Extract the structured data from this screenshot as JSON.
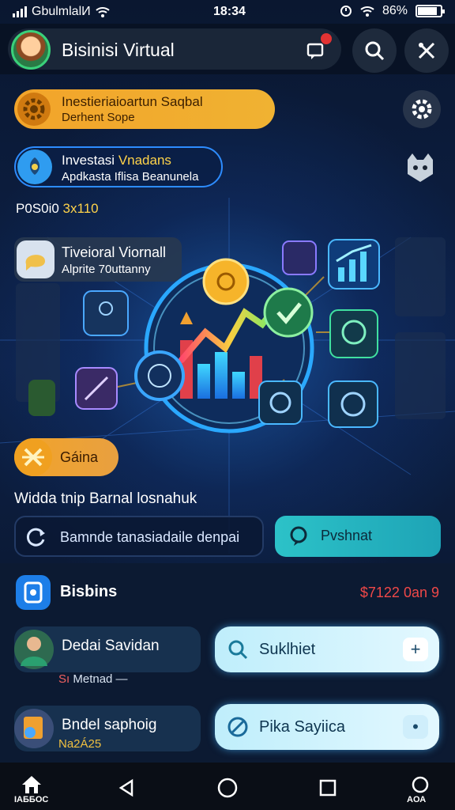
{
  "status_bar": {
    "carrier": "GbulmlalИ",
    "time": "18:34",
    "battery": "86%",
    "battery_level": 0.86
  },
  "header": {
    "title": "Bisinisi Virtual",
    "notification_icon": "message-icon",
    "search_icon": "search-icon",
    "tools_icon": "tools-icon"
  },
  "cards": {
    "orange": {
      "title": "Inestieriaioartun Saqbal",
      "subtitle": "Derhent Sope"
    },
    "blue": {
      "title_prefix": "Investasi ",
      "title_highlight": "Vnadans",
      "subtitle": "Apdkasta Iflisa Beanunela"
    },
    "post": {
      "prefix": "P0S0i0 ",
      "value": "3х110"
    },
    "tiles": {
      "title": "Tiveioral Viornall",
      "subtitle": "Alprite  70uttanny"
    }
  },
  "gain_button": {
    "label": "Gáina"
  },
  "help_text": "Widda tnip Barnal losnahuk",
  "actions": {
    "left": {
      "label": "Bamnde tanasiadaile denpai"
    },
    "right": {
      "label": "Pvshnat"
    }
  },
  "section": {
    "title": "Bisbins",
    "value": "$7122 0an 9",
    "items": [
      {
        "label": "Dedai Savidan",
        "sub_prefix": "Sı",
        "sub_text": " Metnad —",
        "button": "Suklhiet",
        "button_extra": "+"
      },
      {
        "label": "Bndel saphoig",
        "sub_prefix": "",
        "sub_text": "Na2Á25",
        "button": "Pika Sayiica",
        "button_extra": "•"
      }
    ]
  },
  "nav": {
    "home_label": "IАББОС",
    "profile_label": "AОА"
  },
  "colors": {
    "background": "#0b1a33",
    "accent_orange": "#f2a42a",
    "accent_blue": "#2d8cff",
    "accent_teal": "#2cc2c8",
    "accent_red": "#f04848"
  }
}
